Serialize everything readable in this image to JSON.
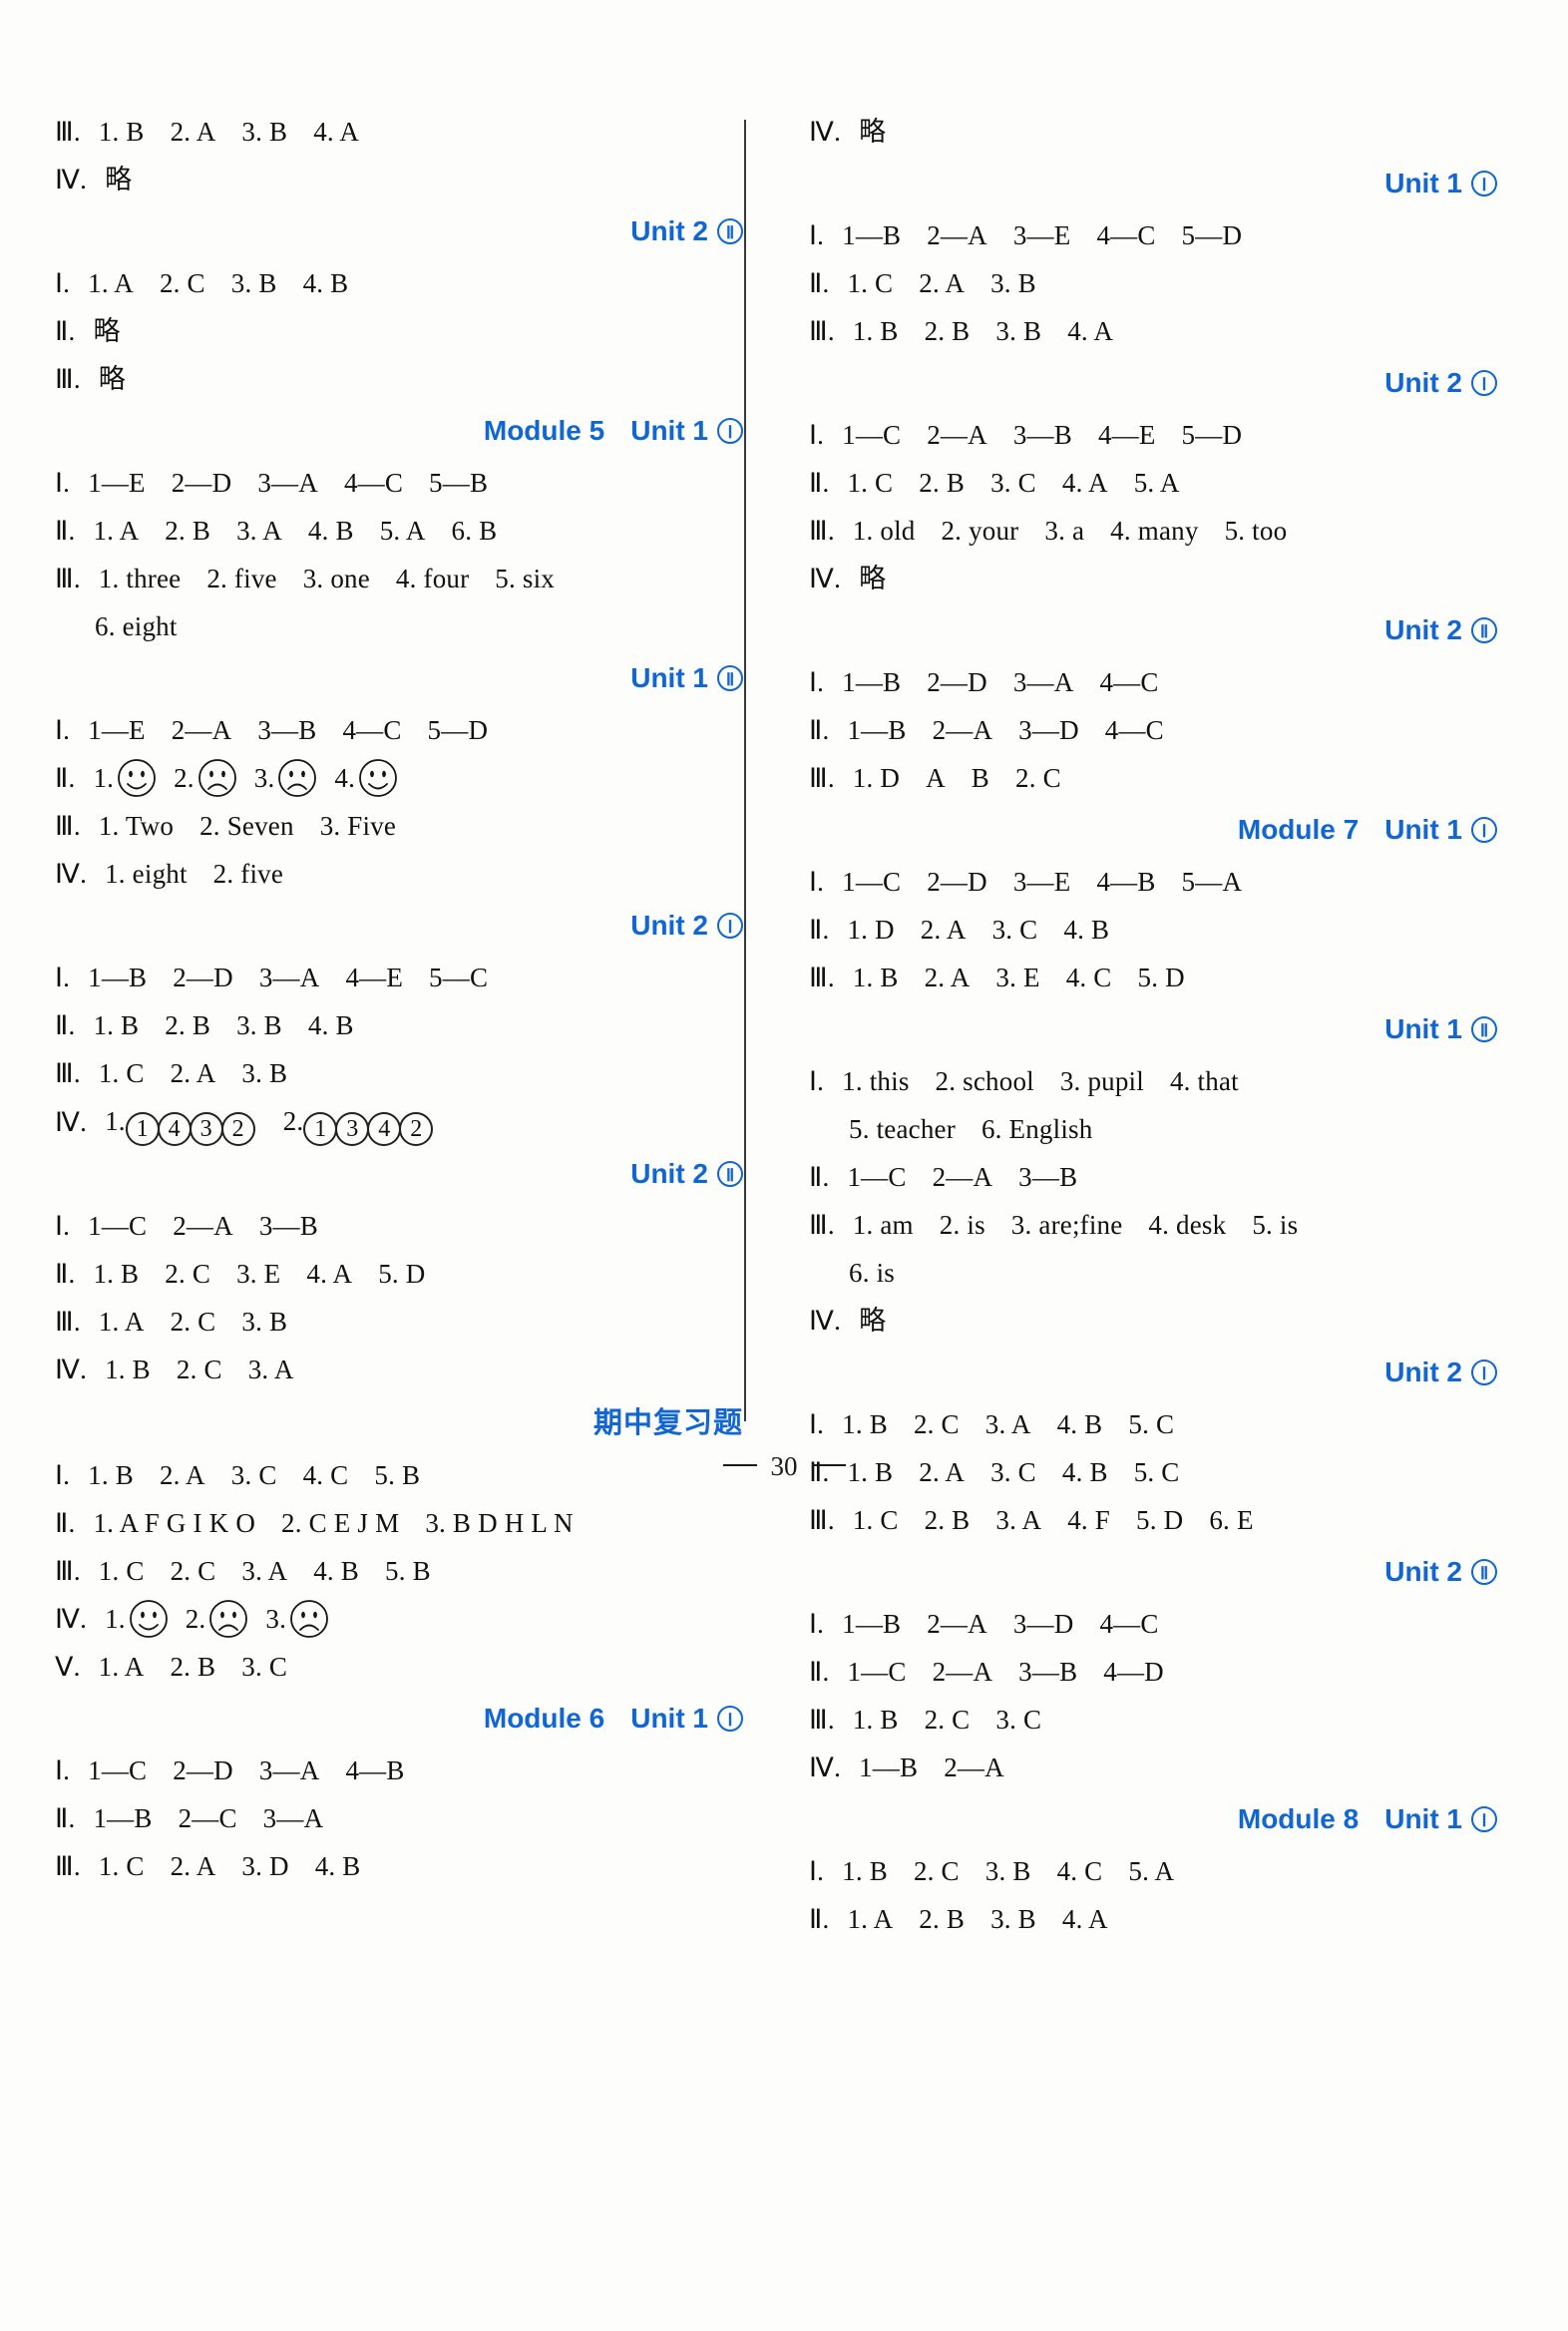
{
  "page": {
    "number": "30"
  },
  "left_column": {
    "blocks": [
      {
        "type": "answers",
        "lines": [
          {
            "marker": "Ⅲ",
            "sep": ".",
            "items": [
              "1. B",
              "2. A",
              "3. B",
              "4. A"
            ]
          },
          {
            "marker": "Ⅳ",
            "sep": ".",
            "items": [
              "略"
            ]
          }
        ]
      },
      {
        "type": "heading",
        "module": "",
        "unit": "Unit 2",
        "roman": "Ⅱ"
      },
      {
        "type": "answers",
        "lines": [
          {
            "marker": "Ⅰ",
            "sep": ".",
            "items": [
              "1. A",
              "2. C",
              "3. B",
              "4. B"
            ]
          },
          {
            "marker": "Ⅱ",
            "sep": ".",
            "items": [
              "略"
            ]
          },
          {
            "marker": "Ⅲ",
            "sep": ".",
            "items": [
              "略"
            ]
          }
        ]
      },
      {
        "type": "heading",
        "module": "Module 5",
        "unit": "Unit 1",
        "roman": "Ⅰ"
      },
      {
        "type": "answers",
        "lines": [
          {
            "marker": "Ⅰ",
            "sep": ".",
            "items": [
              "1—E",
              "2—D",
              "3—A",
              "4—C",
              "5—B"
            ]
          },
          {
            "marker": "Ⅱ",
            "sep": ".",
            "items": [
              "1. A",
              "2. B",
              "3. A",
              "4. B",
              "5. A",
              "6. B"
            ]
          },
          {
            "marker": "Ⅲ",
            "sep": ".",
            "items": [
              "1. three",
              "2. five",
              "3. one",
              "4. four",
              "5. six"
            ]
          },
          {
            "marker": "",
            "sep": "",
            "indent": true,
            "items": [
              "6. eight"
            ]
          }
        ]
      },
      {
        "type": "heading",
        "module": "",
        "unit": "Unit 1",
        "roman": "Ⅱ"
      },
      {
        "type": "answers",
        "lines": [
          {
            "marker": "Ⅰ",
            "sep": ".",
            "items": [
              "1—E",
              "2—A",
              "3—B",
              "4—C",
              "5—D"
            ]
          }
        ]
      },
      {
        "type": "faces",
        "marker": "Ⅱ",
        "sep": ".",
        "faces": [
          {
            "label": "1.",
            "mood": "happy"
          },
          {
            "label": "2.",
            "mood": "sad"
          },
          {
            "label": "3.",
            "mood": "sad"
          },
          {
            "label": "4.",
            "mood": "happy"
          }
        ]
      },
      {
        "type": "answers",
        "lines": [
          {
            "marker": "Ⅲ",
            "sep": ".",
            "items": [
              "1. Two",
              "2. Seven",
              "3. Five"
            ]
          },
          {
            "marker": "Ⅳ",
            "sep": ".",
            "items": [
              "1. eight",
              "2. five"
            ]
          }
        ]
      },
      {
        "type": "heading",
        "module": "",
        "unit": "Unit 2",
        "roman": "Ⅰ"
      },
      {
        "type": "answers",
        "lines": [
          {
            "marker": "Ⅰ",
            "sep": ".",
            "items": [
              "1—B",
              "2—D",
              "3—A",
              "4—E",
              "5—C"
            ]
          },
          {
            "marker": "Ⅱ",
            "sep": ".",
            "items": [
              "1. B",
              "2. B",
              "3. B",
              "4. B"
            ]
          },
          {
            "marker": "Ⅲ",
            "sep": ".",
            "items": [
              "1. C",
              "2. A",
              "3. B"
            ]
          }
        ]
      },
      {
        "type": "circled",
        "marker": "Ⅳ",
        "sep": ".",
        "groups": [
          {
            "label": "1.",
            "digits": [
              "1",
              "4",
              "3",
              "2"
            ]
          },
          {
            "label": "2.",
            "digits": [
              "1",
              "3",
              "4",
              "2"
            ]
          }
        ]
      },
      {
        "type": "heading",
        "module": "",
        "unit": "Unit 2",
        "roman": "Ⅱ"
      },
      {
        "type": "answers",
        "lines": [
          {
            "marker": "Ⅰ",
            "sep": ".",
            "items": [
              "1—C",
              "2—A",
              "3—B"
            ]
          },
          {
            "marker": "Ⅱ",
            "sep": ".",
            "items": [
              "1. B",
              "2. C",
              "3. E",
              "4. A",
              "5. D"
            ]
          },
          {
            "marker": "Ⅲ",
            "sep": ".",
            "items": [
              "1. A",
              "2. C",
              "3. B"
            ]
          },
          {
            "marker": "Ⅳ",
            "sep": ".",
            "items": [
              "1. B",
              "2. C",
              "3. A"
            ]
          }
        ]
      },
      {
        "type": "heading_cn",
        "text": "期中复习题"
      },
      {
        "type": "answers",
        "lines": [
          {
            "marker": "Ⅰ",
            "sep": ".",
            "items": [
              "1. B",
              "2. A",
              "3. C",
              "4. C",
              "5. B"
            ]
          },
          {
            "marker": "Ⅱ",
            "sep": ".",
            "items": [
              "1. A F G I K O",
              "2. C E J M",
              "3. B D H L N"
            ]
          },
          {
            "marker": "Ⅲ",
            "sep": ".",
            "items": [
              "1. C",
              "2. C",
              "3. A",
              "4. B",
              "5. B"
            ]
          }
        ]
      },
      {
        "type": "faces",
        "marker": "Ⅳ",
        "sep": ".",
        "faces": [
          {
            "label": "1.",
            "mood": "happy"
          },
          {
            "label": "2.",
            "mood": "sad"
          },
          {
            "label": "3.",
            "mood": "sad"
          }
        ]
      },
      {
        "type": "answers",
        "lines": [
          {
            "marker": "Ⅴ",
            "sep": ".",
            "items": [
              "1. A",
              "2. B",
              "3. C"
            ]
          }
        ]
      },
      {
        "type": "heading",
        "module": "Module 6",
        "unit": "Unit 1",
        "roman": "Ⅰ"
      },
      {
        "type": "answers",
        "lines": [
          {
            "marker": "Ⅰ",
            "sep": ".",
            "items": [
              "1—C",
              "2—D",
              "3—A",
              "4—B"
            ]
          },
          {
            "marker": "Ⅱ",
            "sep": ".",
            "items": [
              "1—B",
              "2—C",
              "3—A"
            ]
          },
          {
            "marker": "Ⅲ",
            "sep": ".",
            "items": [
              "1. C",
              "2. A",
              "3. D",
              "4. B"
            ]
          }
        ]
      }
    ]
  },
  "right_column": {
    "blocks": [
      {
        "type": "answers",
        "lines": [
          {
            "marker": "Ⅳ",
            "sep": ".",
            "items": [
              "略"
            ]
          }
        ]
      },
      {
        "type": "heading",
        "module": "",
        "unit": "Unit 1",
        "roman": "Ⅰ"
      },
      {
        "type": "answers",
        "lines": [
          {
            "marker": "Ⅰ",
            "sep": ".",
            "items": [
              "1—B",
              "2—A",
              "3—E",
              "4—C",
              "5—D"
            ]
          },
          {
            "marker": "Ⅱ",
            "sep": ".",
            "items": [
              "1. C",
              "2. A",
              "3. B"
            ]
          },
          {
            "marker": "Ⅲ",
            "sep": ".",
            "items": [
              "1. B",
              "2. B",
              "3. B",
              "4. A"
            ]
          }
        ]
      },
      {
        "type": "heading",
        "module": "",
        "unit": "Unit 2",
        "roman": "Ⅰ"
      },
      {
        "type": "answers",
        "lines": [
          {
            "marker": "Ⅰ",
            "sep": ".",
            "items": [
              "1—C",
              "2—A",
              "3—B",
              "4—E",
              "5—D"
            ]
          },
          {
            "marker": "Ⅱ",
            "sep": ".",
            "items": [
              "1. C",
              "2. B",
              "3. C",
              "4. A",
              "5. A"
            ]
          },
          {
            "marker": "Ⅲ",
            "sep": ".",
            "items": [
              "1. old",
              "2. your",
              "3. a",
              "4. many",
              "5. too"
            ]
          },
          {
            "marker": "Ⅳ",
            "sep": ".",
            "items": [
              "略"
            ]
          }
        ]
      },
      {
        "type": "heading",
        "module": "",
        "unit": "Unit 2",
        "roman": "Ⅱ"
      },
      {
        "type": "answers",
        "lines": [
          {
            "marker": "Ⅰ",
            "sep": ".",
            "items": [
              "1—B",
              "2—D",
              "3—A",
              "4—C"
            ]
          },
          {
            "marker": "Ⅱ",
            "sep": ".",
            "items": [
              "1—B",
              "2—A",
              "3—D",
              "4—C"
            ]
          },
          {
            "marker": "Ⅲ",
            "sep": ".",
            "items": [
              "1. D",
              "A",
              "B",
              "2. C"
            ]
          }
        ]
      },
      {
        "type": "heading",
        "module": "Module 7",
        "unit": "Unit 1",
        "roman": "Ⅰ"
      },
      {
        "type": "answers",
        "lines": [
          {
            "marker": "Ⅰ",
            "sep": ".",
            "items": [
              "1—C",
              "2—D",
              "3—E",
              "4—B",
              "5—A"
            ]
          },
          {
            "marker": "Ⅱ",
            "sep": ".",
            "items": [
              "1. D",
              "2. A",
              "3. C",
              "4. B"
            ]
          },
          {
            "marker": "Ⅲ",
            "sep": ".",
            "items": [
              "1. B",
              "2. A",
              "3. E",
              "4. C",
              "5. D"
            ]
          }
        ]
      },
      {
        "type": "heading",
        "module": "",
        "unit": "Unit 1",
        "roman": "Ⅱ"
      },
      {
        "type": "answers",
        "lines": [
          {
            "marker": "Ⅰ",
            "sep": ".",
            "items": [
              "1. this",
              "2. school",
              "3. pupil",
              "4. that"
            ]
          },
          {
            "marker": "",
            "sep": "",
            "indent": true,
            "items": [
              "5. teacher",
              "6. English"
            ]
          },
          {
            "marker": "Ⅱ",
            "sep": ".",
            "items": [
              "1—C",
              "2—A",
              "3—B"
            ]
          },
          {
            "marker": "Ⅲ",
            "sep": ".",
            "items": [
              "1. am",
              "2. is",
              "3. are;fine",
              "4. desk",
              "5. is"
            ]
          },
          {
            "marker": "",
            "sep": "",
            "indent": true,
            "items": [
              "6. is"
            ]
          },
          {
            "marker": "Ⅳ",
            "sep": ".",
            "items": [
              "略"
            ]
          }
        ]
      },
      {
        "type": "heading",
        "module": "",
        "unit": "Unit 2",
        "roman": "Ⅰ"
      },
      {
        "type": "answers",
        "lines": [
          {
            "marker": "Ⅰ",
            "sep": ".",
            "items": [
              "1. B",
              "2. C",
              "3. A",
              "4. B",
              "5. C"
            ]
          },
          {
            "marker": "Ⅱ",
            "sep": ".",
            "items": [
              "1. B",
              "2. A",
              "3. C",
              "4. B",
              "5. C"
            ]
          },
          {
            "marker": "Ⅲ",
            "sep": ".",
            "items": [
              "1. C",
              "2. B",
              "3. A",
              "4. F",
              "5. D",
              "6. E"
            ]
          }
        ]
      },
      {
        "type": "heading",
        "module": "",
        "unit": "Unit 2",
        "roman": "Ⅱ"
      },
      {
        "type": "answers",
        "lines": [
          {
            "marker": "Ⅰ",
            "sep": ".",
            "items": [
              "1—B",
              "2—A",
              "3—D",
              "4—C"
            ]
          },
          {
            "marker": "Ⅱ",
            "sep": ".",
            "items": [
              "1—C",
              "2—A",
              "3—B",
              "4—D"
            ]
          },
          {
            "marker": "Ⅲ",
            "sep": ".",
            "items": [
              "1. B",
              "2. C",
              "3. C"
            ]
          },
          {
            "marker": "Ⅳ",
            "sep": ".",
            "items": [
              "1—B",
              "2—A"
            ]
          }
        ]
      },
      {
        "type": "heading",
        "module": "Module 8",
        "unit": "Unit 1",
        "roman": "Ⅰ"
      },
      {
        "type": "answers",
        "lines": [
          {
            "marker": "Ⅰ",
            "sep": ".",
            "items": [
              "1. B",
              "2. C",
              "3. B",
              "4. C",
              "5. A"
            ]
          },
          {
            "marker": "Ⅱ",
            "sep": ".",
            "items": [
              "1. A",
              "2. B",
              "3. B",
              "4. A"
            ]
          }
        ]
      }
    ]
  }
}
